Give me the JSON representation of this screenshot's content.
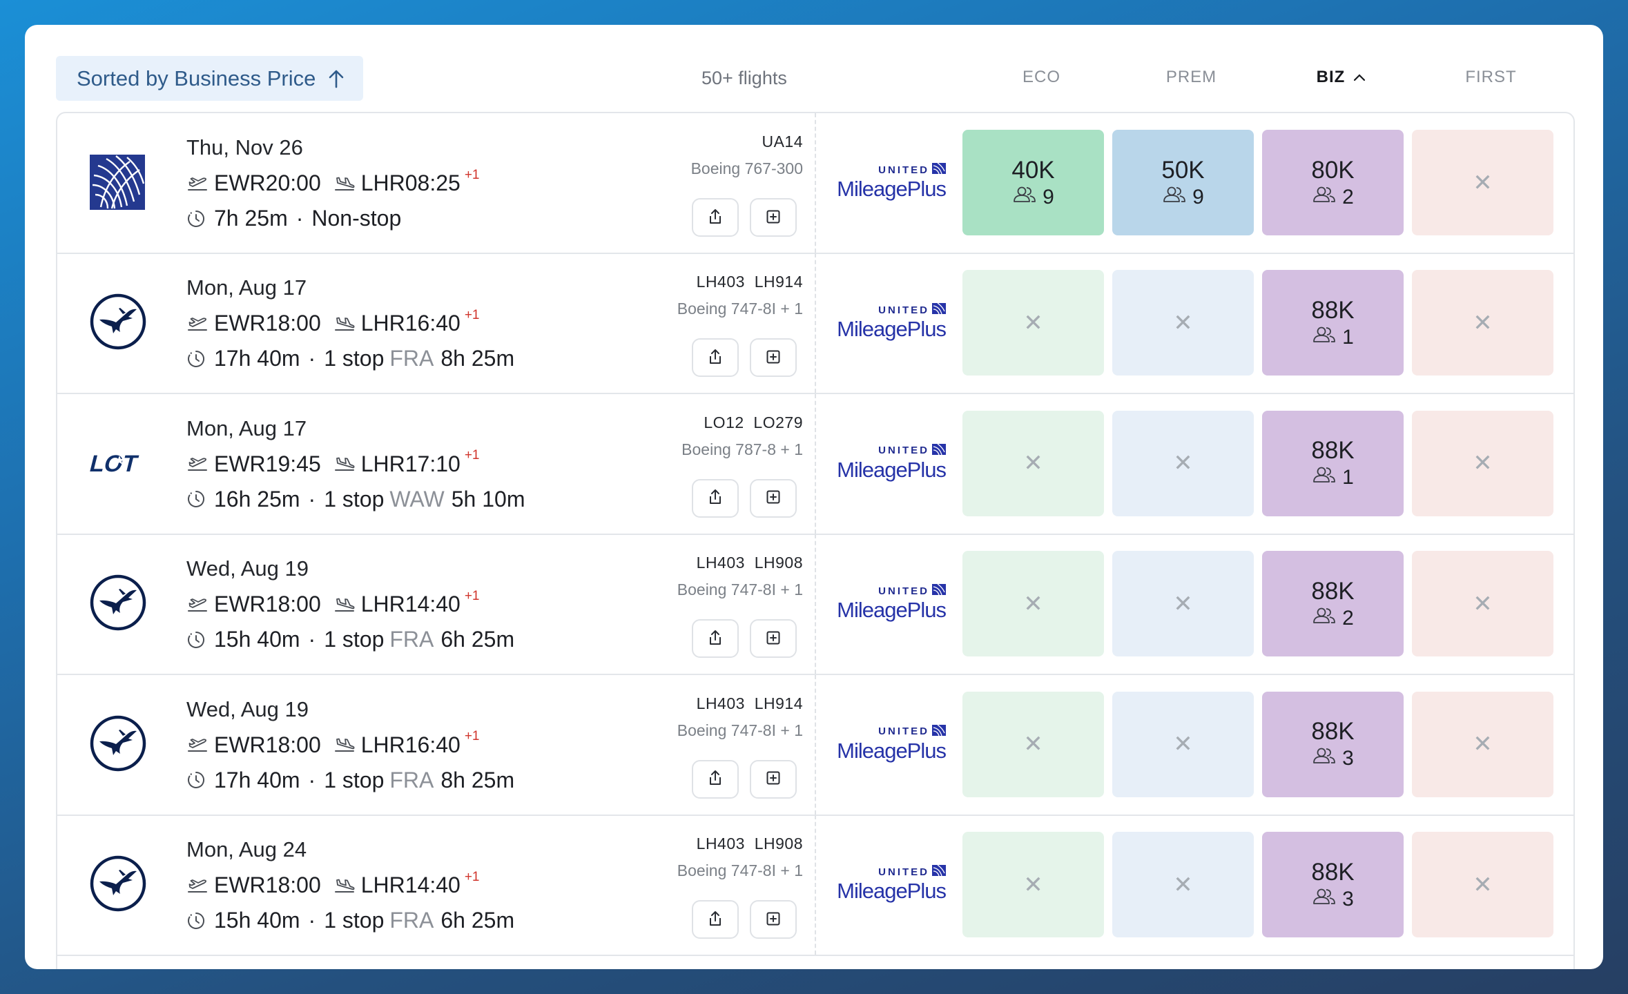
{
  "header": {
    "sort_label": "Sorted by Business Price",
    "flight_count": "50+ flights",
    "columns": [
      "ECO",
      "PREM",
      "BIZ",
      "FIRST"
    ],
    "active_column": "BIZ"
  },
  "program": {
    "top": "UNITED",
    "name": "MileagePlus"
  },
  "flights": [
    {
      "airline_logo": "united-globe-logo",
      "date": "Thu, Nov 26",
      "origin": "EWR",
      "dep_time": "20:00",
      "destination": "LHR",
      "arr_time": "08:25",
      "day_offset": "+1",
      "duration": "7h 25m",
      "stops": "Non-stop",
      "via": "",
      "layover": "",
      "flight_numbers": "UA14",
      "aircraft": "Boeing 767-300",
      "eco": {
        "points": "40K",
        "seats": "9"
      },
      "prem": {
        "points": "50K",
        "seats": "9"
      },
      "biz": {
        "points": "80K",
        "seats": "2"
      },
      "first": null
    },
    {
      "airline_logo": "lufthansa-crane-logo",
      "date": "Mon, Aug 17",
      "origin": "EWR",
      "dep_time": "18:00",
      "destination": "LHR",
      "arr_time": "16:40",
      "day_offset": "+1",
      "duration": "17h 40m",
      "stops": "1 stop",
      "via": "FRA",
      "layover": "8h 25m",
      "flight_numbers": "LH403  LH914",
      "aircraft": "Boeing 747-8I  + 1",
      "eco": null,
      "prem": null,
      "biz": {
        "points": "88K",
        "seats": "1"
      },
      "first": null
    },
    {
      "airline_logo": "lot-logo",
      "date": "Mon, Aug 17",
      "origin": "EWR",
      "dep_time": "19:45",
      "destination": "LHR",
      "arr_time": "17:10",
      "day_offset": "+1",
      "duration": "16h 25m",
      "stops": "1 stop",
      "via": "WAW",
      "layover": "5h 10m",
      "flight_numbers": "LO12  LO279",
      "aircraft": "Boeing 787-8  + 1",
      "eco": null,
      "prem": null,
      "biz": {
        "points": "88K",
        "seats": "1"
      },
      "first": null
    },
    {
      "airline_logo": "lufthansa-crane-logo",
      "date": "Wed, Aug 19",
      "origin": "EWR",
      "dep_time": "18:00",
      "destination": "LHR",
      "arr_time": "14:40",
      "day_offset": "+1",
      "duration": "15h 40m",
      "stops": "1 stop",
      "via": "FRA",
      "layover": "6h 25m",
      "flight_numbers": "LH403  LH908",
      "aircraft": "Boeing 747-8I  + 1",
      "eco": null,
      "prem": null,
      "biz": {
        "points": "88K",
        "seats": "2"
      },
      "first": null
    },
    {
      "airline_logo": "lufthansa-crane-logo",
      "date": "Wed, Aug 19",
      "origin": "EWR",
      "dep_time": "18:00",
      "destination": "LHR",
      "arr_time": "16:40",
      "day_offset": "+1",
      "duration": "17h 40m",
      "stops": "1 stop",
      "via": "FRA",
      "layover": "8h 25m",
      "flight_numbers": "LH403  LH914",
      "aircraft": "Boeing 747-8I  + 1",
      "eco": null,
      "prem": null,
      "biz": {
        "points": "88K",
        "seats": "3"
      },
      "first": null
    },
    {
      "airline_logo": "lufthansa-crane-logo",
      "date": "Mon, Aug 24",
      "origin": "EWR",
      "dep_time": "18:00",
      "destination": "LHR",
      "arr_time": "14:40",
      "day_offset": "+1",
      "duration": "15h 40m",
      "stops": "1 stop",
      "via": "FRA",
      "layover": "6h 25m",
      "flight_numbers": "LH403  LH908",
      "aircraft": "Boeing 747-8I  + 1",
      "eco": null,
      "prem": null,
      "biz": {
        "points": "88K",
        "seats": "3"
      },
      "first": null
    }
  ],
  "unavailable_symbol": "✕",
  "colors": {
    "eco": "#a9e1c4",
    "prem": "#b9d6ea",
    "biz": "#d4bfe1",
    "first": "#f8e9e7",
    "accent_red": "#d0342c",
    "program_blue": "#2633a8"
  }
}
